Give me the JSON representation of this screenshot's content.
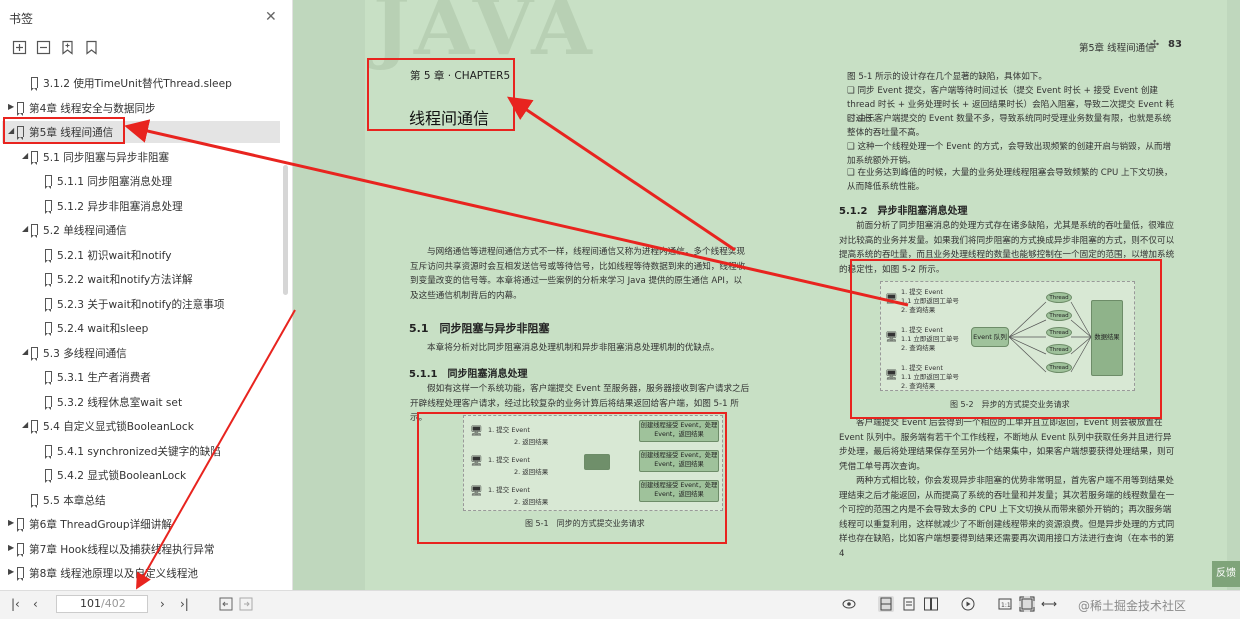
{
  "sidebar": {
    "title": "书签",
    "items": [
      {
        "label": "3.1.2 使用TimeUnit替代Thread.sleep",
        "caret": ""
      },
      {
        "label": "第4章 线程安全与数据同步",
        "caret": "▶"
      },
      {
        "label": "第5章 线程间通信",
        "caret": "◢"
      },
      {
        "label": "5.1 同步阻塞与异步非阻塞",
        "caret": "◢"
      },
      {
        "label": "5.1.1 同步阻塞消息处理",
        "caret": ""
      },
      {
        "label": "5.1.2 异步非阻塞消息处理",
        "caret": ""
      },
      {
        "label": "5.2 单线程间通信",
        "caret": "◢"
      },
      {
        "label": "5.2.1 初识wait和notify",
        "caret": ""
      },
      {
        "label": "5.2.2 wait和notify方法详解",
        "caret": ""
      },
      {
        "label": "5.2.3 关于wait和notify的注意事项",
        "caret": ""
      },
      {
        "label": "5.2.4 wait和sleep",
        "caret": ""
      },
      {
        "label": "5.3 多线程间通信",
        "caret": "◢"
      },
      {
        "label": "5.3.1 生产者消费者",
        "caret": ""
      },
      {
        "label": "5.3.2 线程休息室wait set",
        "caret": ""
      },
      {
        "label": "5.4 自定义显式锁BooleanLock",
        "caret": "◢"
      },
      {
        "label": "5.4.1 synchronized关键字的缺陷",
        "caret": ""
      },
      {
        "label": "5.4.2 显式锁BooleanLock",
        "caret": ""
      },
      {
        "label": "5.5 本章总结",
        "caret": ""
      },
      {
        "label": "第6章 ThreadGroup详细讲解",
        "caret": "▶"
      },
      {
        "label": "第7章 Hook线程以及捕获线程执行异常",
        "caret": "▶"
      },
      {
        "label": "第8章 线程池原理以及自定义线程池",
        "caret": "▶"
      }
    ]
  },
  "page": {
    "watermark": "JAVA",
    "header_chapter": "第5章 线程间通信",
    "page_number": "83",
    "chapter_small": "第 5 章 · CHAPTER5",
    "chapter_title": "线程间通信",
    "intro": "与网络通信等进程间通信方式不一样，线程间通信又称为进程内通信，多个线程实现互斥访问共享资源时会互相发送信号或等待信号，比如线程等待数据到来的通知，线程收到变量改变的信号等。本章将通过一些案例的分析来学习 Java 提供的原生通信 API，以及这些通信机制背后的内幕。",
    "sec51": "5.1　同步阻塞与异步非阻塞",
    "sec51_desc": "本章将分析对比同步阻塞消息处理机制和异步非阻塞消息处理机制的优缺点。",
    "sec511": "5.1.1　同步阻塞消息处理",
    "sec511_text": "假如有这样一个系统功能，客户端提交 Event 至服务器，服务器接收到客户请求之后开辟线程处理客户请求，经过比较复杂的业务计算后将结果返回给客户端，如图 5-1 所示。",
    "fig51_caption": "图 5-1　同步的方式提交业务请求",
    "fig51_submit": "1. 提交 Event",
    "fig51_return": "2. 返回结果",
    "fig51_box": "创建线程接受 Event，处理 Event，返回结果",
    "right_intro": "图 5-1 所示的设计存在几个显著的缺陷，具体如下。",
    "bullets": [
      "同步 Event 提交，客户端等待时间过长（提交 Event 时长 + 接受 Event 创建 thread 时长 + 业务处理时长 + 返回结果时长）会陷入阻塞，导致二次提交 Event 耗时过长。",
      "由于客户端提交的 Event 数量不多，导致系统同时受理业务数量有限，也就是系统整体的吞吐量不高。",
      "这种一个线程处理一个 Event 的方式，会导致出现频繁的创建开启与销毁，从而增加系统额外开销。",
      "在业务达到峰值的时候，大量的业务处理线程阻塞会导致频繁的 CPU 上下文切换，从而降低系统性能。"
    ],
    "sec512": "5.1.2　异步非阻塞消息处理",
    "sec512_text": "前面分析了同步阻塞消息的处理方式存在诸多缺陷，尤其是系统的吞吐量低，很难应对比较高的业务并发量。如果我们将同步阻塞的方式换成异步非阻塞的方式，则不仅可以提高系统的吞吐量，而且业务处理线程的数量也能够控制在一个固定的范围，以增加系统的稳定性，如图 5-2 所示。",
    "fig52_caption": "图 5-2　异步的方式提交业务请求",
    "fig52_submit": "1. 提交 Event",
    "fig52_ack": "1.1 立即返回工单号",
    "fig52_query": "2. 查询结果",
    "fig52_queue": "Event 队列",
    "fig52_thread": "Thread",
    "fig52_db": "数据结果",
    "right_lower": "客户端提交 Event 后会得到一个相应的工单并且立即返回，Event 则会被放置在 Event 队列中。服务端有若干个工作线程，不断地从 Event 队列中获取任务并且进行异步处理，最后将处理结果保存至另外一个结果集中，如果客户端想要获得处理结果，则可凭借工单号再次查询。",
    "right_lower2": "两种方式相比较，你会发现异步非阻塞的优势非常明显，首先客户端不用等到结果处理结束之后才能返回，从而提高了系统的吞吐量和并发量；其次若服务端的线程数量在一个可控的范围之内是不会导致太多的 CPU 上下文切换从而带来额外开销的；再次服务端线程可以重复利用，这样就减少了不断创建线程带来的资源浪费。但是异步处理的方式同样也存在缺陷，比如客户端想要得到结果还需要再次调用接口方法进行查询（在本书的第 4",
    "feedback": "反馈"
  },
  "bottom": {
    "current_page": "101",
    "total_pages": "/402",
    "watermark": "@稀土掘金技术社区"
  },
  "colors": {
    "annotation": "#e8241f",
    "page_bg": "#c8e0c5",
    "doc_bg": "#bfd7bd"
  }
}
